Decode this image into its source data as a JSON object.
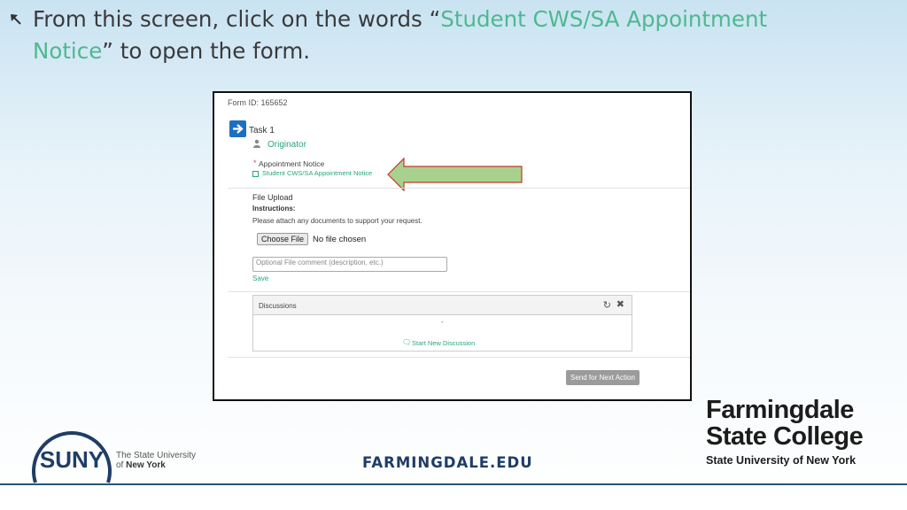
{
  "slide": {
    "headline_pre": "From this screen, click on the words “",
    "headline_link1": "Student CWS/SA  Appointment",
    "headline_link2": "Notice",
    "headline_post": "” to open the form."
  },
  "form": {
    "form_id": "Form ID: 165652",
    "task_label": "Task 1",
    "originator": "Originator",
    "required_star": "*",
    "appointment_label": "Appointment Notice",
    "appointment_link": "Student CWS/SA Appointment Notice",
    "file_upload_title": "File Upload",
    "instructions_label": "Instructions:",
    "instructions_text": "Please attach any documents to support your request.",
    "choose_file_label": "Choose File",
    "no_file_text": "No file chosen",
    "comment_placeholder": "Optional File comment (description, etc.)",
    "save_label": "Save",
    "discussions_title": "Discussions",
    "discussions_empty": "-",
    "start_discussion": "Start New Discussion",
    "send_button": "Send for Next Action"
  },
  "footer": {
    "suny_logo_text": "SUNY",
    "suny_line1": "The State University",
    "suny_line2_prefix": "of ",
    "suny_line2_bold": "New York",
    "website": "FARMINGDALE.EDU",
    "college_line1": "Farmingdale",
    "college_line2": "State College",
    "college_line3": "State University of New York"
  },
  "icons": {
    "bullet": "arrow-up-left-icon",
    "task": "arrow-right-icon",
    "person": "person-icon",
    "refresh": "refresh-icon",
    "close": "close-icon",
    "comment": "comment-icon",
    "pointer": "left-arrow-pointer"
  },
  "colors": {
    "accent_green": "#4fb88f",
    "link_green": "#2aa57d",
    "task_blue": "#1d6fc3",
    "pointer_fill": "#a9d18e",
    "pointer_stroke": "#c0392b",
    "navy": "#1f3d66"
  }
}
